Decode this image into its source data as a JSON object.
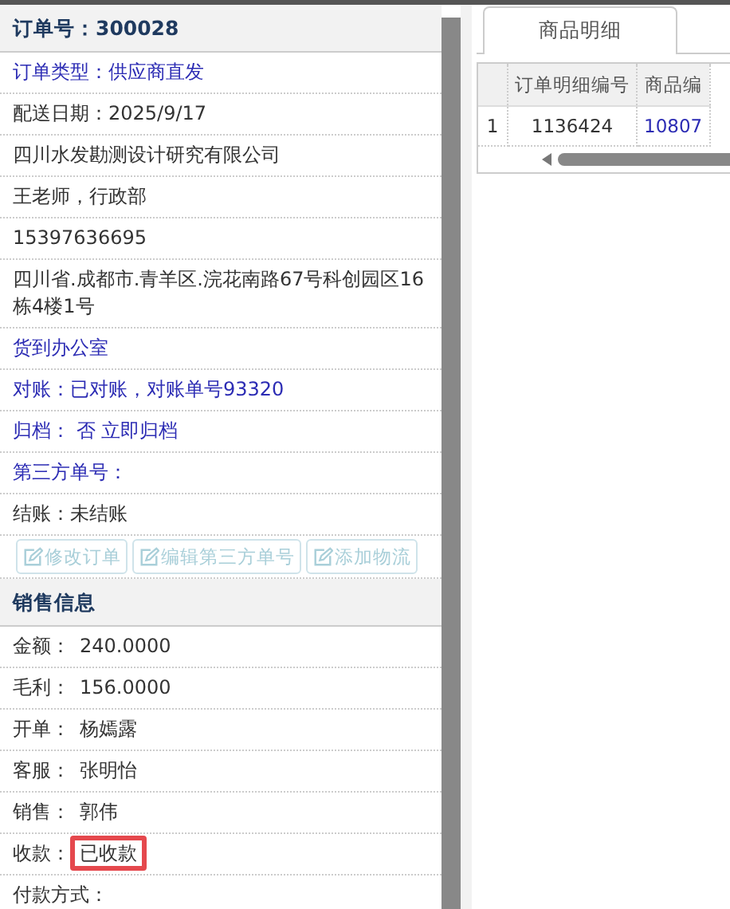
{
  "order_panel": {
    "title": "订单号：300028",
    "rows": [
      {
        "text": "订单类型：供应商直发",
        "link": true
      },
      {
        "text": "配送日期：2025/9/17",
        "link": false
      },
      {
        "text": "四川水发勘测设计研究有限公司",
        "link": false
      },
      {
        "text": "王老师，行政部",
        "link": false
      },
      {
        "text": "15397636695",
        "link": false
      },
      {
        "text": "四川省.成都市.青羊区.浣花南路67号科创园区16栋4楼1号",
        "link": false
      },
      {
        "text": "货到办公室",
        "link": true
      },
      {
        "text": "对账：已对账，对账单号93320",
        "link": true
      },
      {
        "text": "归档： 否 立即归档",
        "link": true
      },
      {
        "text": "第三方单号：",
        "link": true
      },
      {
        "text": "结账：未结账",
        "link": false
      }
    ],
    "buttons": [
      {
        "label": "修改订单",
        "disabled": true
      },
      {
        "label": "编辑第三方单号",
        "disabled": true
      },
      {
        "label": "添加物流",
        "disabled": true
      }
    ]
  },
  "sales_panel": {
    "title": "销售信息",
    "rows": [
      {
        "label": "金额：",
        "value": "240.0000",
        "highlighted": false
      },
      {
        "label": "毛利：",
        "value": "156.0000",
        "highlighted": false
      },
      {
        "label": "开单：",
        "value": "杨嫣露",
        "highlighted": false
      },
      {
        "label": "客服：",
        "value": "张明怡",
        "highlighted": false
      },
      {
        "label": "销售：",
        "value": "郭伟",
        "highlighted": false
      },
      {
        "label": "收款：",
        "value": "已收款",
        "highlighted": true
      },
      {
        "label": "付款方式："
      }
    ]
  },
  "tabs": [
    {
      "label": "商品明细",
      "selected": true
    }
  ],
  "table": {
    "columns": [
      "订单明细编号",
      "商品编"
    ],
    "rows": [
      {
        "index": "1",
        "cells": [
          {
            "text": "1136424",
            "link": false
          },
          {
            "text": "10807",
            "link": true
          }
        ]
      }
    ]
  }
}
